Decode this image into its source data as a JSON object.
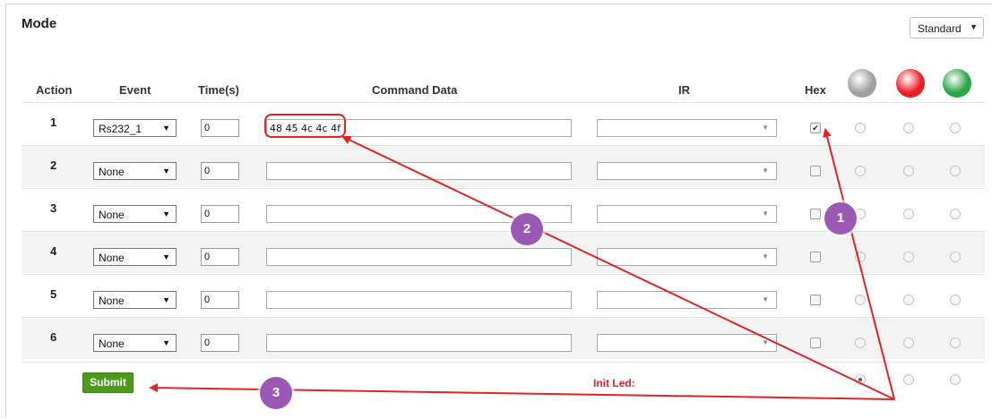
{
  "panel": {
    "title": "Mode",
    "mode_value": "Standard"
  },
  "headers": {
    "action": "Action",
    "event": "Event",
    "time": "Time(s)",
    "command": "Command Data",
    "ir": "IR",
    "hex": "Hex"
  },
  "leds": [
    {
      "name": "gray-led-icon",
      "color": "#a0a0a0"
    },
    {
      "name": "red-led-icon",
      "color": "#ee1c25"
    },
    {
      "name": "green-led-icon",
      "color": "#28a745"
    }
  ],
  "rows": [
    {
      "action": "1",
      "event": "Rs232_1",
      "time": "0",
      "command": "48 45 4c 4c 4f",
      "hex_checked": true
    },
    {
      "action": "2",
      "event": "None",
      "time": "0",
      "command": "",
      "hex_checked": false
    },
    {
      "action": "3",
      "event": "None",
      "time": "0",
      "command": "",
      "hex_checked": false
    },
    {
      "action": "4",
      "event": "None",
      "time": "0",
      "command": "",
      "hex_checked": false
    },
    {
      "action": "5",
      "event": "None",
      "time": "0",
      "command": "",
      "hex_checked": false
    },
    {
      "action": "6",
      "event": "None",
      "time": "0",
      "command": "",
      "hex_checked": false
    }
  ],
  "footer": {
    "submit_label": "Submit",
    "init_led_label": "Init Led:",
    "init_led_selected": 0
  },
  "annotations": {
    "color": "#e02424",
    "badges": [
      {
        "label": "1"
      },
      {
        "label": "2"
      },
      {
        "label": "3"
      }
    ]
  }
}
